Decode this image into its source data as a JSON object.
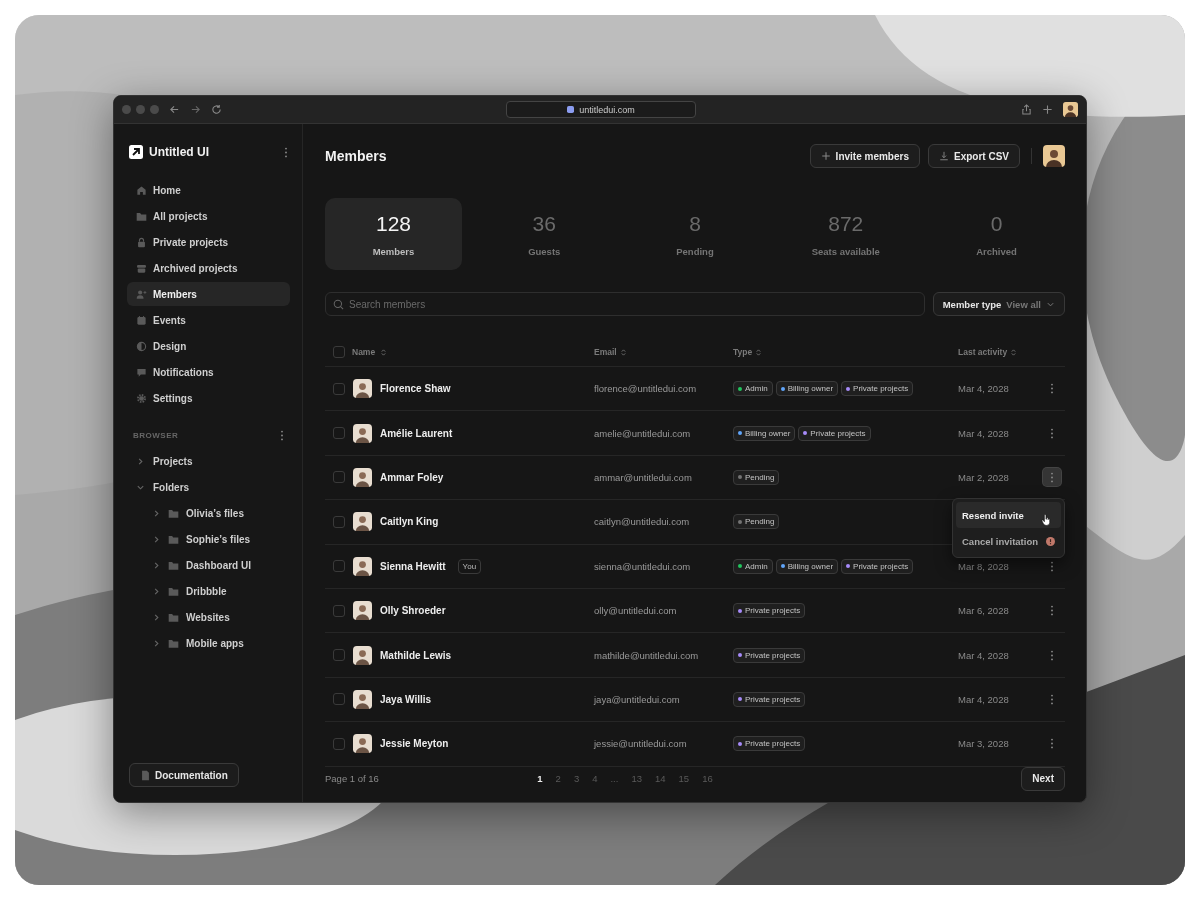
{
  "browser": {
    "url": "untitledui.com"
  },
  "sidebar": {
    "brand": "Untitled UI",
    "nav": [
      {
        "label": "Home",
        "selected": false
      },
      {
        "label": "All projects",
        "selected": false
      },
      {
        "label": "Private projects",
        "selected": false
      },
      {
        "label": "Archived projects",
        "selected": false
      },
      {
        "label": "Members",
        "selected": true
      },
      {
        "label": "Events",
        "selected": false
      },
      {
        "label": "Design",
        "selected": false
      },
      {
        "label": "Notifications",
        "selected": false
      },
      {
        "label": "Settings",
        "selected": false
      }
    ],
    "section_label": "BROWSER",
    "tree": [
      {
        "label": "Projects",
        "expanded": false
      },
      {
        "label": "Folders",
        "expanded": true,
        "children": [
          {
            "label": "Olivia’s files",
            "expanded": false
          },
          {
            "label": "Sophie’s files",
            "expanded": false
          },
          {
            "label": "Dashboard UI",
            "expanded": false
          },
          {
            "label": "Dribbble",
            "expanded": false
          },
          {
            "label": "Websites",
            "expanded": false
          },
          {
            "label": "Mobile apps",
            "expanded": false
          }
        ]
      }
    ],
    "documentation": "Documentation"
  },
  "header": {
    "title": "Members",
    "buttons": [
      "Invite members",
      "Export CSV"
    ]
  },
  "stats": [
    {
      "value": "128",
      "label": "Members",
      "selected": true
    },
    {
      "value": "36",
      "label": "Guests",
      "selected": false
    },
    {
      "value": "8",
      "label": "Pending",
      "selected": false
    },
    {
      "value": "872",
      "label": "Seats available",
      "selected": false
    },
    {
      "value": "0",
      "label": "Archived",
      "selected": false
    }
  ],
  "search": {
    "placeholder": "Search members"
  },
  "filter": {
    "label": "Member type",
    "value": "View all"
  },
  "table": {
    "columns": [
      "Name",
      "Email",
      "Type",
      "Last activity"
    ],
    "all_checked": false,
    "rows": [
      {
        "name": "Florence Shaw",
        "email": "florence@untitledui.com",
        "date": "Mar 4, 2028",
        "checked": false,
        "menu_open": false,
        "tags": [
          {
            "label": "Admin",
            "color": "#22c55e"
          },
          {
            "label": "Billing owner",
            "color": "#60a5fa"
          },
          {
            "label": "Private projects",
            "color": "#a78bfa"
          }
        ]
      },
      {
        "name": "Amélie Laurent",
        "email": "amelie@untitledui.com",
        "date": "Mar 4, 2028",
        "checked": false,
        "menu_open": false,
        "tags": [
          {
            "label": "Billing owner",
            "color": "#60a5fa"
          },
          {
            "label": "Private projects",
            "color": "#a78bfa"
          }
        ]
      },
      {
        "name": "Ammar Foley",
        "email": "ammar@untitledui.com",
        "date": "Mar 2, 2028",
        "checked": false,
        "menu_open": true,
        "tags": [
          {
            "label": "Pending",
            "color": "#737373"
          }
        ]
      },
      {
        "name": "Caitlyn King",
        "email": "caitlyn@untitledui.com",
        "checked": false,
        "tags": [
          {
            "label": "Pending",
            "color": "#737373"
          }
        ]
      },
      {
        "name": "Sienna Hewitt",
        "badge": "You",
        "email": "sienna@untitledui.com",
        "date": "Mar 8, 2028",
        "checked": false,
        "menu_open": false,
        "tags": [
          {
            "label": "Admin",
            "color": "#22c55e"
          },
          {
            "label": "Billing owner",
            "color": "#60a5fa"
          },
          {
            "label": "Private projects",
            "color": "#a78bfa"
          }
        ]
      },
      {
        "name": "Olly Shroeder",
        "email": "olly@untitledui.com",
        "date": "Mar 6, 2028",
        "checked": false,
        "menu_open": false,
        "tags": [
          {
            "label": "Private projects",
            "color": "#a78bfa"
          }
        ]
      },
      {
        "name": "Mathilde Lewis",
        "email": "mathilde@untitledui.com",
        "date": "Mar 4, 2028",
        "checked": false,
        "menu_open": false,
        "tags": [
          {
            "label": "Private projects",
            "color": "#a78bfa"
          }
        ]
      },
      {
        "name": "Jaya Willis",
        "email": "jaya@untitledui.com",
        "date": "Mar 4, 2028",
        "checked": false,
        "menu_open": false,
        "tags": [
          {
            "label": "Private projects",
            "color": "#a78bfa"
          }
        ]
      },
      {
        "name": "Jessie Meyton",
        "email": "jessie@untitledui.com",
        "date": "Mar 3, 2028",
        "checked": false,
        "menu_open": false,
        "tags": [
          {
            "label": "Private projects",
            "color": "#a78bfa"
          }
        ]
      }
    ]
  },
  "row_menu": {
    "items": [
      {
        "label": "Resend invite",
        "hovered": true,
        "kind": "plain"
      },
      {
        "label": "Cancel invitation",
        "hovered": false,
        "kind": "warning"
      }
    ]
  },
  "pagination": {
    "label": "Page 1 of 16",
    "pages": [
      {
        "label": "1",
        "selected": true
      },
      {
        "label": "2",
        "selected": false
      },
      {
        "label": "3",
        "selected": false
      },
      {
        "label": "4",
        "selected": false
      },
      {
        "label": "...",
        "selected": false
      },
      {
        "label": "13",
        "selected": false
      },
      {
        "label": "14",
        "selected": false
      },
      {
        "label": "15",
        "selected": false
      },
      {
        "label": "16",
        "selected": false
      }
    ],
    "next": "Next"
  }
}
